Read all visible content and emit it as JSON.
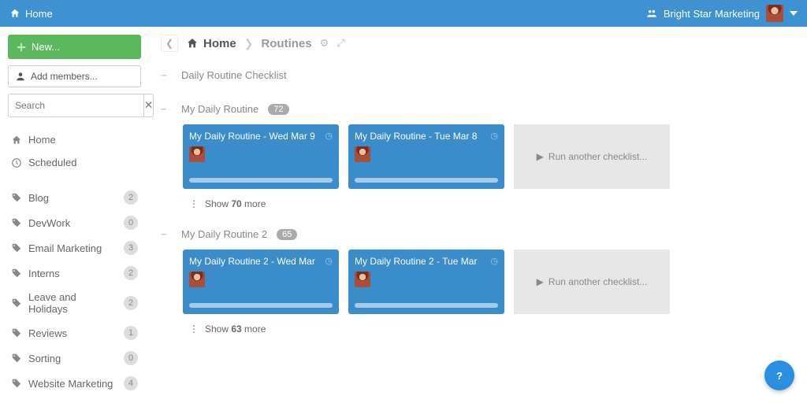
{
  "topbar": {
    "home": "Home",
    "org": "Bright Star Marketing"
  },
  "sidebar": {
    "new": "New...",
    "addMembers": "Add members...",
    "searchPlaceholder": "Search",
    "primary": [
      {
        "label": "Home"
      },
      {
        "label": "Scheduled"
      }
    ],
    "tags": [
      {
        "label": "Blog",
        "count": "2"
      },
      {
        "label": "DevWork",
        "count": "0"
      },
      {
        "label": "Email Marketing",
        "count": "3"
      },
      {
        "label": "Interns",
        "count": "2"
      },
      {
        "label": "Leave and Holidays",
        "count": "2"
      },
      {
        "label": "Reviews",
        "count": "1"
      },
      {
        "label": "Sorting",
        "count": "0"
      },
      {
        "label": "Website Marketing",
        "count": "4"
      }
    ]
  },
  "crumbs": {
    "home": "Home",
    "routines": "Routines"
  },
  "sections": [
    {
      "title": "Daily Routine Checklist"
    },
    {
      "title": "My Daily Routine",
      "count": "72",
      "cards": [
        {
          "title": "My Daily Routine - Wed Mar 9"
        },
        {
          "title": "My Daily Routine - Tue Mar 8"
        }
      ],
      "run": "Run another checklist...",
      "morePrefix": "Show ",
      "moreCount": "70",
      "moreSuffix": " more"
    },
    {
      "title": "My Daily Routine 2",
      "count": "65",
      "cards": [
        {
          "title": "My Daily Routine 2 - Wed Mar"
        },
        {
          "title": "My Daily Routine 2 - Tue Mar"
        }
      ],
      "run": "Run another checklist...",
      "morePrefix": "Show ",
      "moreCount": "63",
      "moreSuffix": " more"
    }
  ]
}
